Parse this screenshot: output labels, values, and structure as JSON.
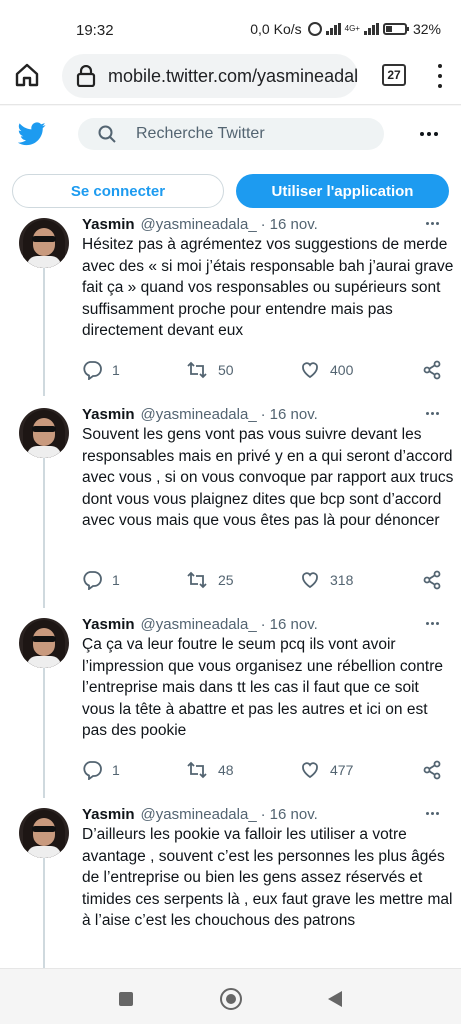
{
  "status_bar": {
    "time": "19:32",
    "speed": "0,0 Ko/s",
    "network": "4G+",
    "battery": "32%"
  },
  "browser": {
    "url": "mobile.twitter.com/yasmineadala",
    "tab_count": "27"
  },
  "header": {
    "search_placeholder": "Recherche Twitter"
  },
  "buttons": {
    "login": "Se connecter",
    "app": "Utiliser l'application"
  },
  "tweets": [
    {
      "name": "Yasmin",
      "handle": "@yasmineadala_",
      "sep": "·",
      "date": "16 nov.",
      "text": "Hésitez pas à agrémentez vos suggestions de merde avec des « si moi j’étais responsable bah j’aurai grave fait ça » quand vos responsables ou supérieurs sont suffisamment proche pour entendre mais pas directement devant eux",
      "replies": "1",
      "retweets": "50",
      "likes": "400"
    },
    {
      "name": "Yasmin",
      "handle": "@yasmineadala_",
      "sep": "·",
      "date": "16 nov.",
      "text": "Souvent les gens vont pas vous suivre devant les responsables mais en privé y en a qui seront d’accord avec vous , si on vous convoque par rapport aux trucs dont vous vous plaignez dites que bcp sont d’accord avec vous mais que vous êtes pas là pour dénoncer",
      "replies": "1",
      "retweets": "25",
      "likes": "318"
    },
    {
      "name": "Yasmin",
      "handle": "@yasmineadala_",
      "sep": "·",
      "date": "16 nov.",
      "text": "Ça ça va leur foutre le seum pcq ils vont avoir l’impression que vous organisez une rébellion contre l’entreprise mais dans tt les cas il faut que ce soit vous la tête à abattre et pas les autres et ici on est pas des pookie",
      "replies": "1",
      "retweets": "48",
      "likes": "477"
    },
    {
      "name": "Yasmin",
      "handle": "@yasmineadala_",
      "sep": "·",
      "date": "16 nov.",
      "text": "D’ailleurs les pookie va falloir les utiliser a votre avantage , souvent c’est les personnes les plus âgés de l’entreprise ou bien les gens assez réservés et timides ces serpents là , eux faut grave les mettre mal à l’aise c’est les chouchous des patrons"
    }
  ],
  "icons": {
    "home": "home-icon",
    "lock": "lock-icon",
    "search": "search-icon",
    "logo": "twitter-bird-icon",
    "reply": "reply-icon",
    "retweet": "retweet-icon",
    "like": "heart-icon",
    "share": "share-icon"
  },
  "colors": {
    "accent": "#1d9bf0",
    "text": "#0f1419",
    "muted": "#536471"
  }
}
